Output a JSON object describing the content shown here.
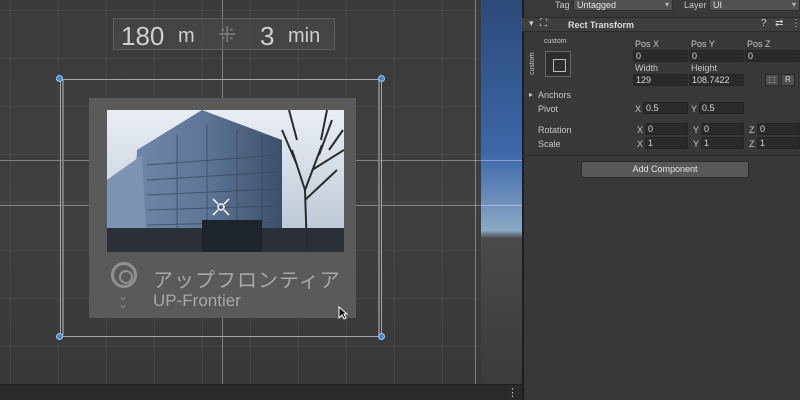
{
  "scene": {
    "timer": {
      "value1": "180",
      "unit1": "m",
      "separator": "⁜",
      "value2": "3",
      "unit2": "min"
    },
    "card": {
      "name_jp": "アップフロンティア",
      "name_en": "UP-Frontier"
    },
    "more_label": "⋮"
  },
  "inspector": {
    "tag_label": "Tag",
    "tag_value": "Untagged",
    "layer_label": "Layer",
    "layer_value": "UI",
    "component": {
      "title": "Rect Transform",
      "help_icon": "?",
      "settings_icon": "⇄",
      "menu_icon": "⋮",
      "custom_label": "custom",
      "custom_vertical": "custom",
      "pos_x_label": "Pos X",
      "pos_y_label": "Pos Y",
      "pos_z_label": "Pos Z",
      "pos_x": "0",
      "pos_y": "0",
      "pos_z": "0",
      "width_label": "Width",
      "height_label": "Height",
      "width": "129",
      "height": "108.7422",
      "blueprint_btn": "⬚",
      "raw_btn": "R",
      "anchors_label": "Anchors",
      "pivot_label": "Pivot",
      "pivot_x_label": "X",
      "pivot_x": "0.5",
      "pivot_y_label": "Y",
      "pivot_y": "0.5",
      "rotation_label": "Rotation",
      "rot_x_label": "X",
      "rot_x": "0",
      "rot_y_label": "Y",
      "rot_y": "0",
      "rot_z_label": "Z",
      "rot_z": "0",
      "scale_label": "Scale",
      "scale_x_label": "X",
      "scale_x": "1",
      "scale_y_label": "Y",
      "scale_y": "1",
      "scale_z_label": "Z",
      "scale_z": "1"
    },
    "add_component": "Add Component"
  },
  "colors": {
    "selection_handle": "#3f87d8",
    "inspector_bg": "#383838",
    "scene_bg": "#3e3e3e"
  }
}
